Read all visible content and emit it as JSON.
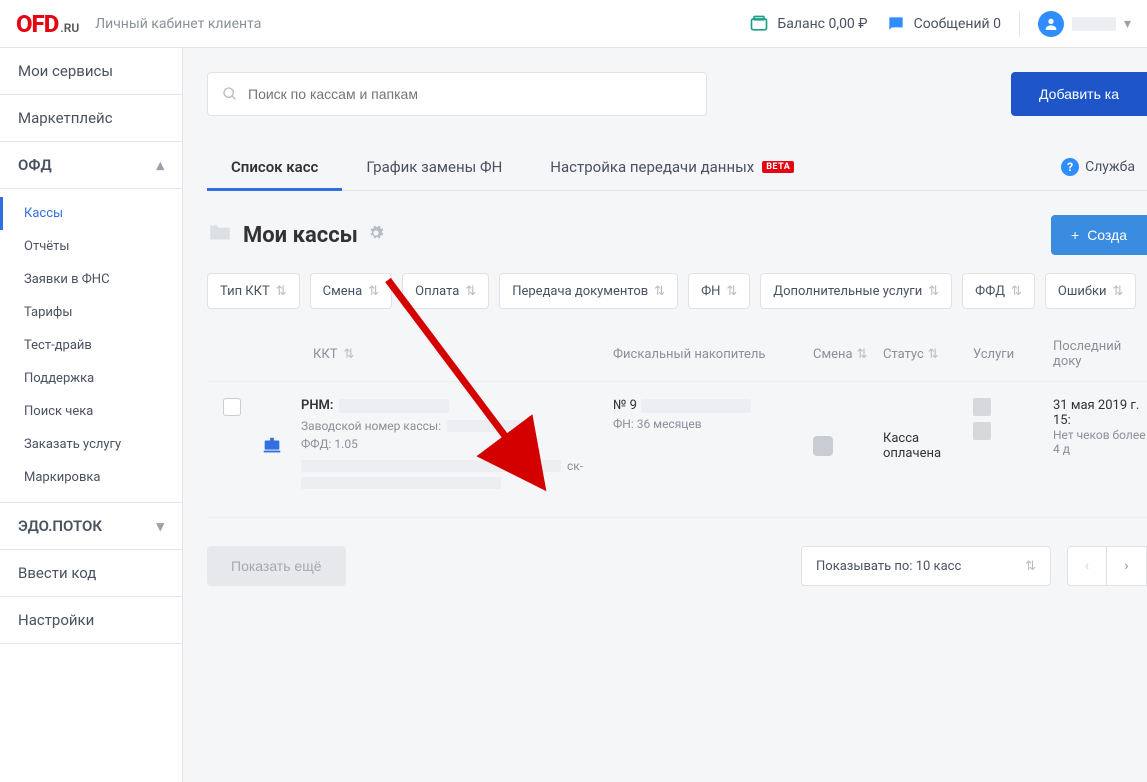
{
  "header": {
    "logo_main": "OFD",
    "logo_suffix": ".RU",
    "subtitle": "Личный кабинет клиента",
    "balance_label": "Баланс 0,00 ₽",
    "messages_label": "Сообщений 0"
  },
  "sidebar": {
    "sections": {
      "my_services": "Мои сервисы",
      "marketplace": "Маркетплейс",
      "ofd": "ОФД",
      "edo": "ЭДО.ПОТОК",
      "enter_code": "Ввести код",
      "settings": "Настройки"
    },
    "ofd_items": [
      "Кассы",
      "Отчёты",
      "Заявки в ФНС",
      "Тарифы",
      "Тест-драйв",
      "Поддержка",
      "Поиск чека",
      "Заказать услугу",
      "Маркировка"
    ]
  },
  "main": {
    "search_placeholder": "Поиск по кассам и папкам",
    "add_btn": "Добавить ка",
    "tabs": {
      "list": "Список касс",
      "fn_schedule": "График замены ФН",
      "transfer": "Настройка передачи данных",
      "beta": "BETA"
    },
    "support_link": "Служба",
    "page_title": "Мои кассы",
    "create_btn": "Созда",
    "filters": [
      "Тип ККТ",
      "Смена",
      "Оплата",
      "Передача документов",
      "ФН",
      "Дополнительные услуги",
      "ФФД",
      "Ошибки"
    ],
    "columns": {
      "kkt": "ККТ",
      "fn": "Фискальный накопитель",
      "smena": "Смена",
      "status": "Статус",
      "services": "Услуги",
      "last_doc": "Последний доку"
    },
    "row": {
      "rnm_label": "РНМ:",
      "factory_label": "Заводской номер кассы:",
      "ffd_label": "ФФД: 1.05",
      "address_suffix": "ск-",
      "fn_no_prefix": "№ 9",
      "fn_duration": "ФН: 36 месяцев",
      "status_text": "Касса оплачена",
      "last_doc_date": "31 мая 2019 г. 15:",
      "last_doc_note": "Нет чеков более 4 д"
    },
    "show_more": "Показать ещё",
    "per_page": "Показывать по: 10 касс"
  }
}
